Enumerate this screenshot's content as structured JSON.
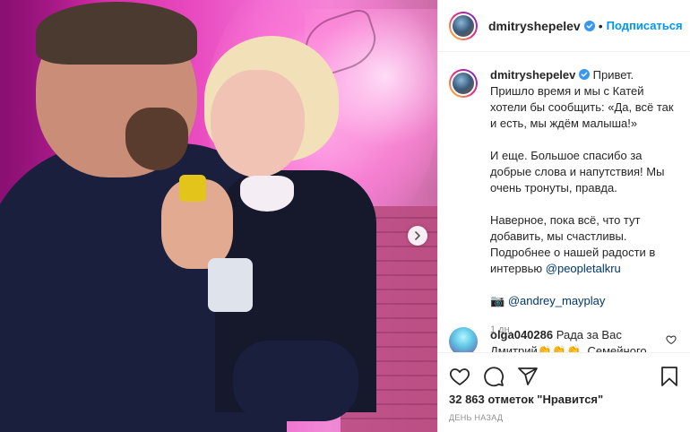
{
  "post": {
    "username": "dmitryshepelev",
    "follow_label": "Подписаться",
    "separator": "•"
  },
  "caption": {
    "username": "dmitryshepelev",
    "paragraph1": "Привет. Пришло время и мы с Катей хотели бы сообщить: «Да, всё так и есть, мы ждём малыша!»",
    "paragraph2": "И еще. Большое спасибо за добрые слова и напутствия! Мы очень тронуты, правда.",
    "paragraph3_pre": "Наверное, пока всё, что тут добавить, мы счастливы. Подробнее о нашей радости в интервью",
    "paragraph3_mention": "@peopletalkru",
    "camera_emoji": "📷",
    "photo_credit": "@andrey_mayplay",
    "time": "1 дн."
  },
  "comment": {
    "username": "olga040286",
    "text": "Рада за Вас Дмитрий👏👏👏. Семейного"
  },
  "stats": {
    "likes": "32 863 отметок \"Нравится\"",
    "posted": "ДЕНЬ НАЗАД"
  },
  "icons": {
    "like": "heart-icon",
    "comment": "comment-icon",
    "share": "share-icon",
    "save": "bookmark-icon",
    "next": "chevron-right-icon",
    "verified": "verified-badge-icon"
  },
  "colors": {
    "accent": "#0095f6",
    "mention": "#00376b",
    "muted": "#8e8e8e"
  }
}
